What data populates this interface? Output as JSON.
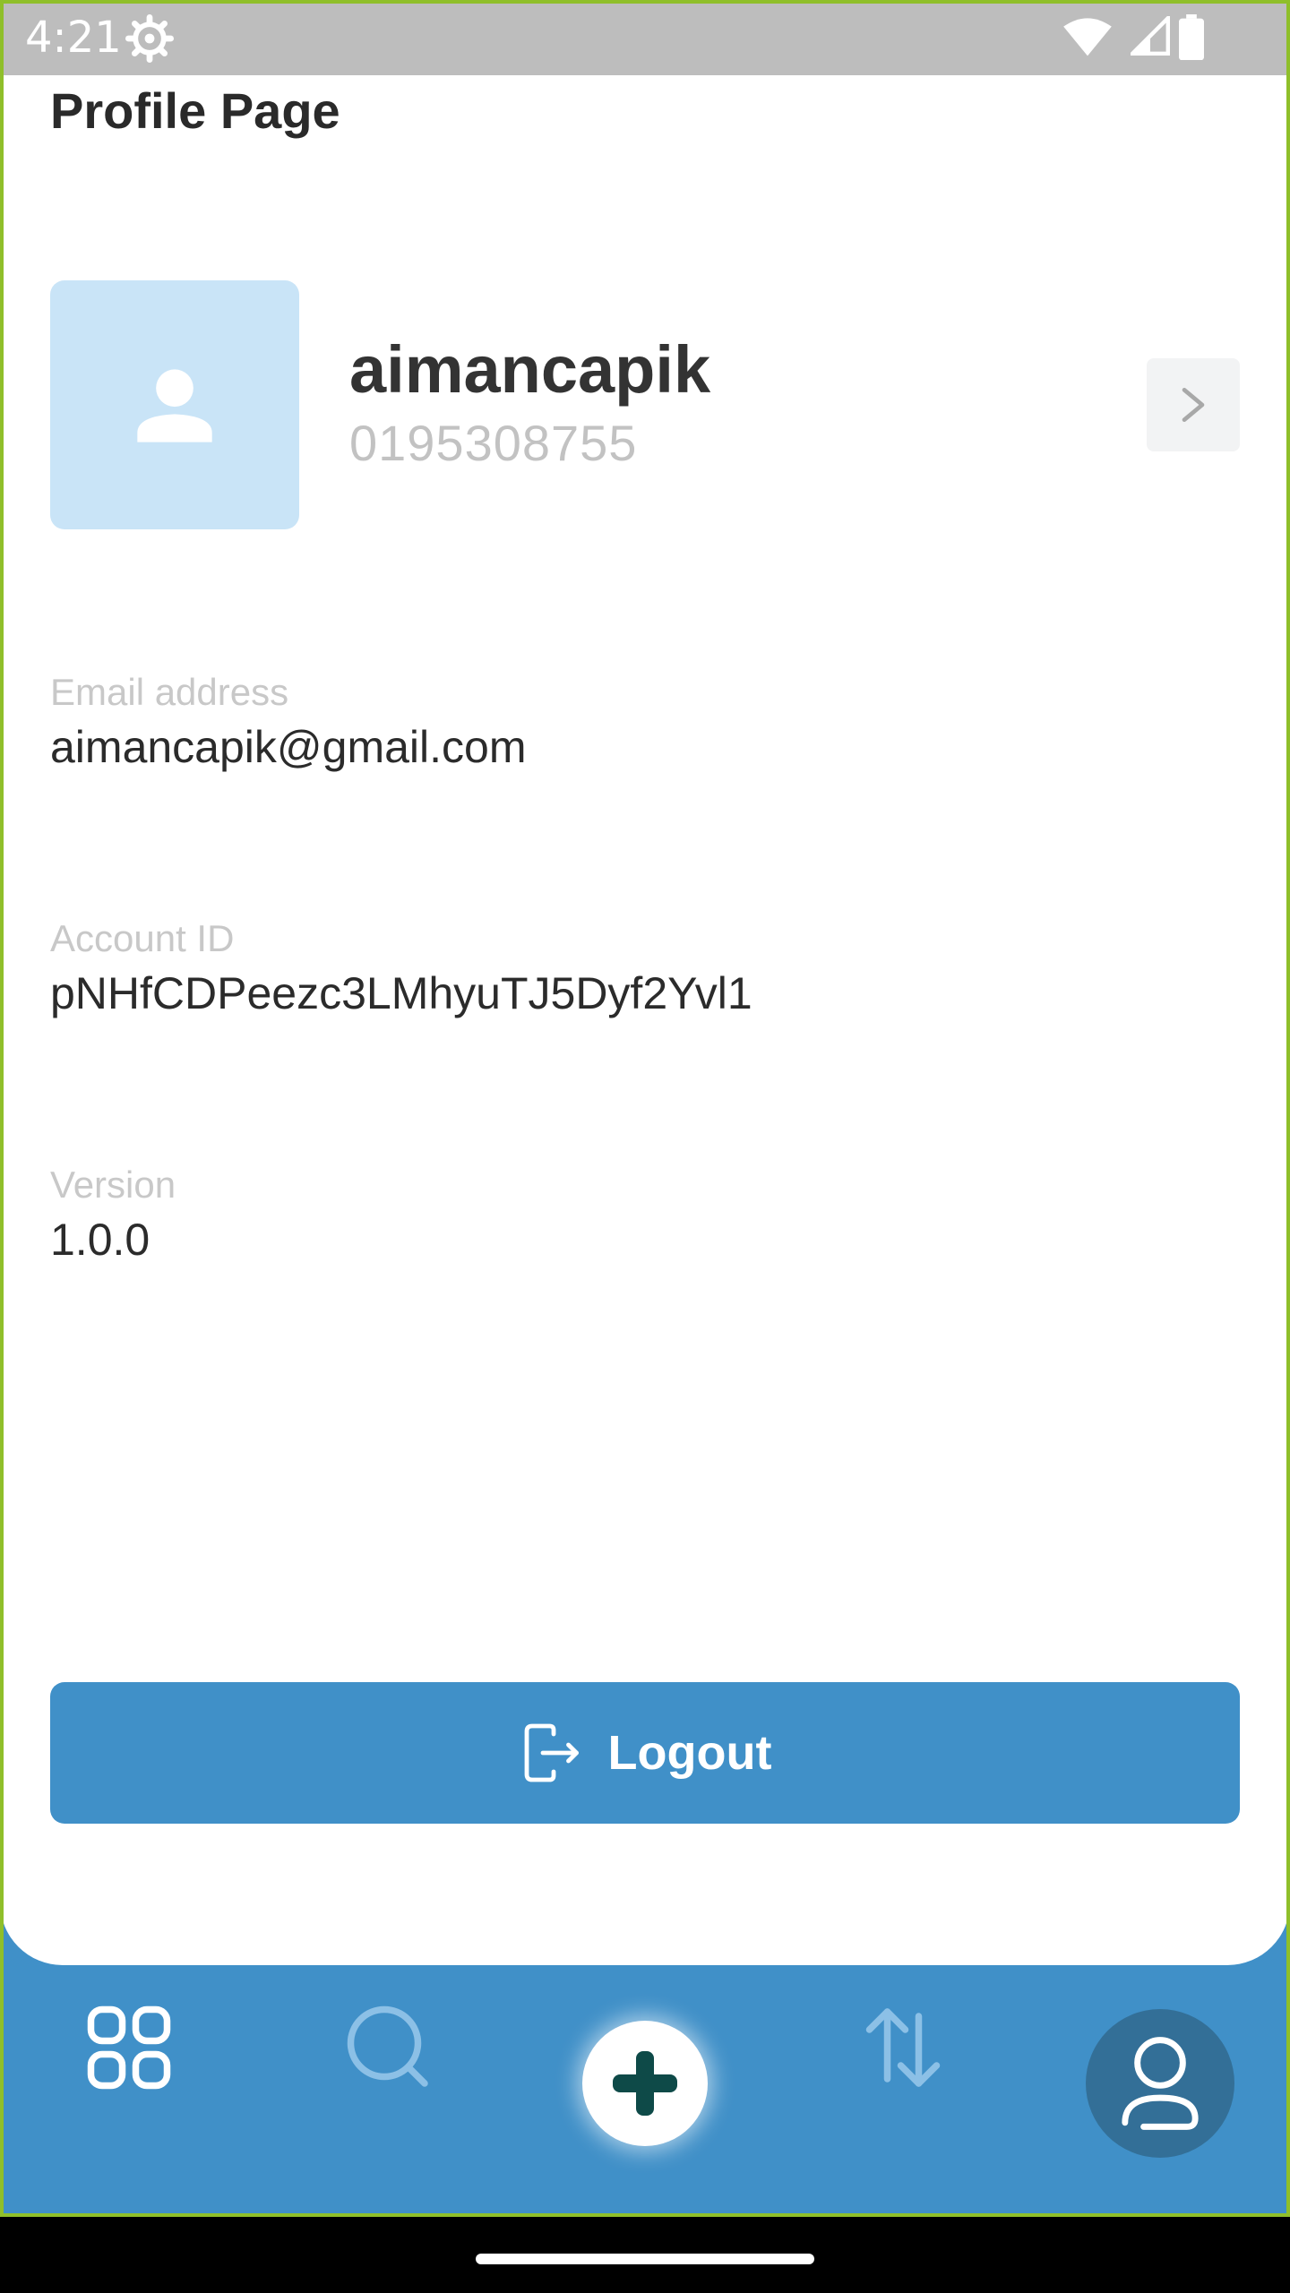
{
  "status_bar": {
    "time": "4:21",
    "icons": [
      "gear-icon",
      "wifi-icon",
      "signal-icon",
      "battery-icon"
    ]
  },
  "page": {
    "title": "Profile Page"
  },
  "profile": {
    "avatar_icon": "person-icon",
    "username": "aimancapik",
    "phone": "0195308755",
    "chevron_icon": "chevron-right-icon"
  },
  "info": {
    "email": {
      "label": "Email address",
      "value": "aimancapik@gmail.com"
    },
    "account": {
      "label": "Account ID",
      "value": "pNHfCDPeezc3LMhyuTJ5Dyf2Yvl1"
    },
    "version": {
      "label": "Version",
      "value": "1.0.0"
    }
  },
  "logout": {
    "label": "Logout",
    "icon": "logout-icon"
  },
  "bottom_nav": {
    "items": [
      "dashboard-icon",
      "search-icon",
      "add-icon",
      "transfer-icon",
      "profile-icon"
    ],
    "active": "profile-icon"
  },
  "colors": {
    "primary": "#4090c8",
    "avatar_bg": "#c9e4f7",
    "active_nav_bg": "#336f97",
    "add_icon": "#0e4a48",
    "status_bar": "#bdbdbd",
    "frame": "#8fbf2a"
  }
}
